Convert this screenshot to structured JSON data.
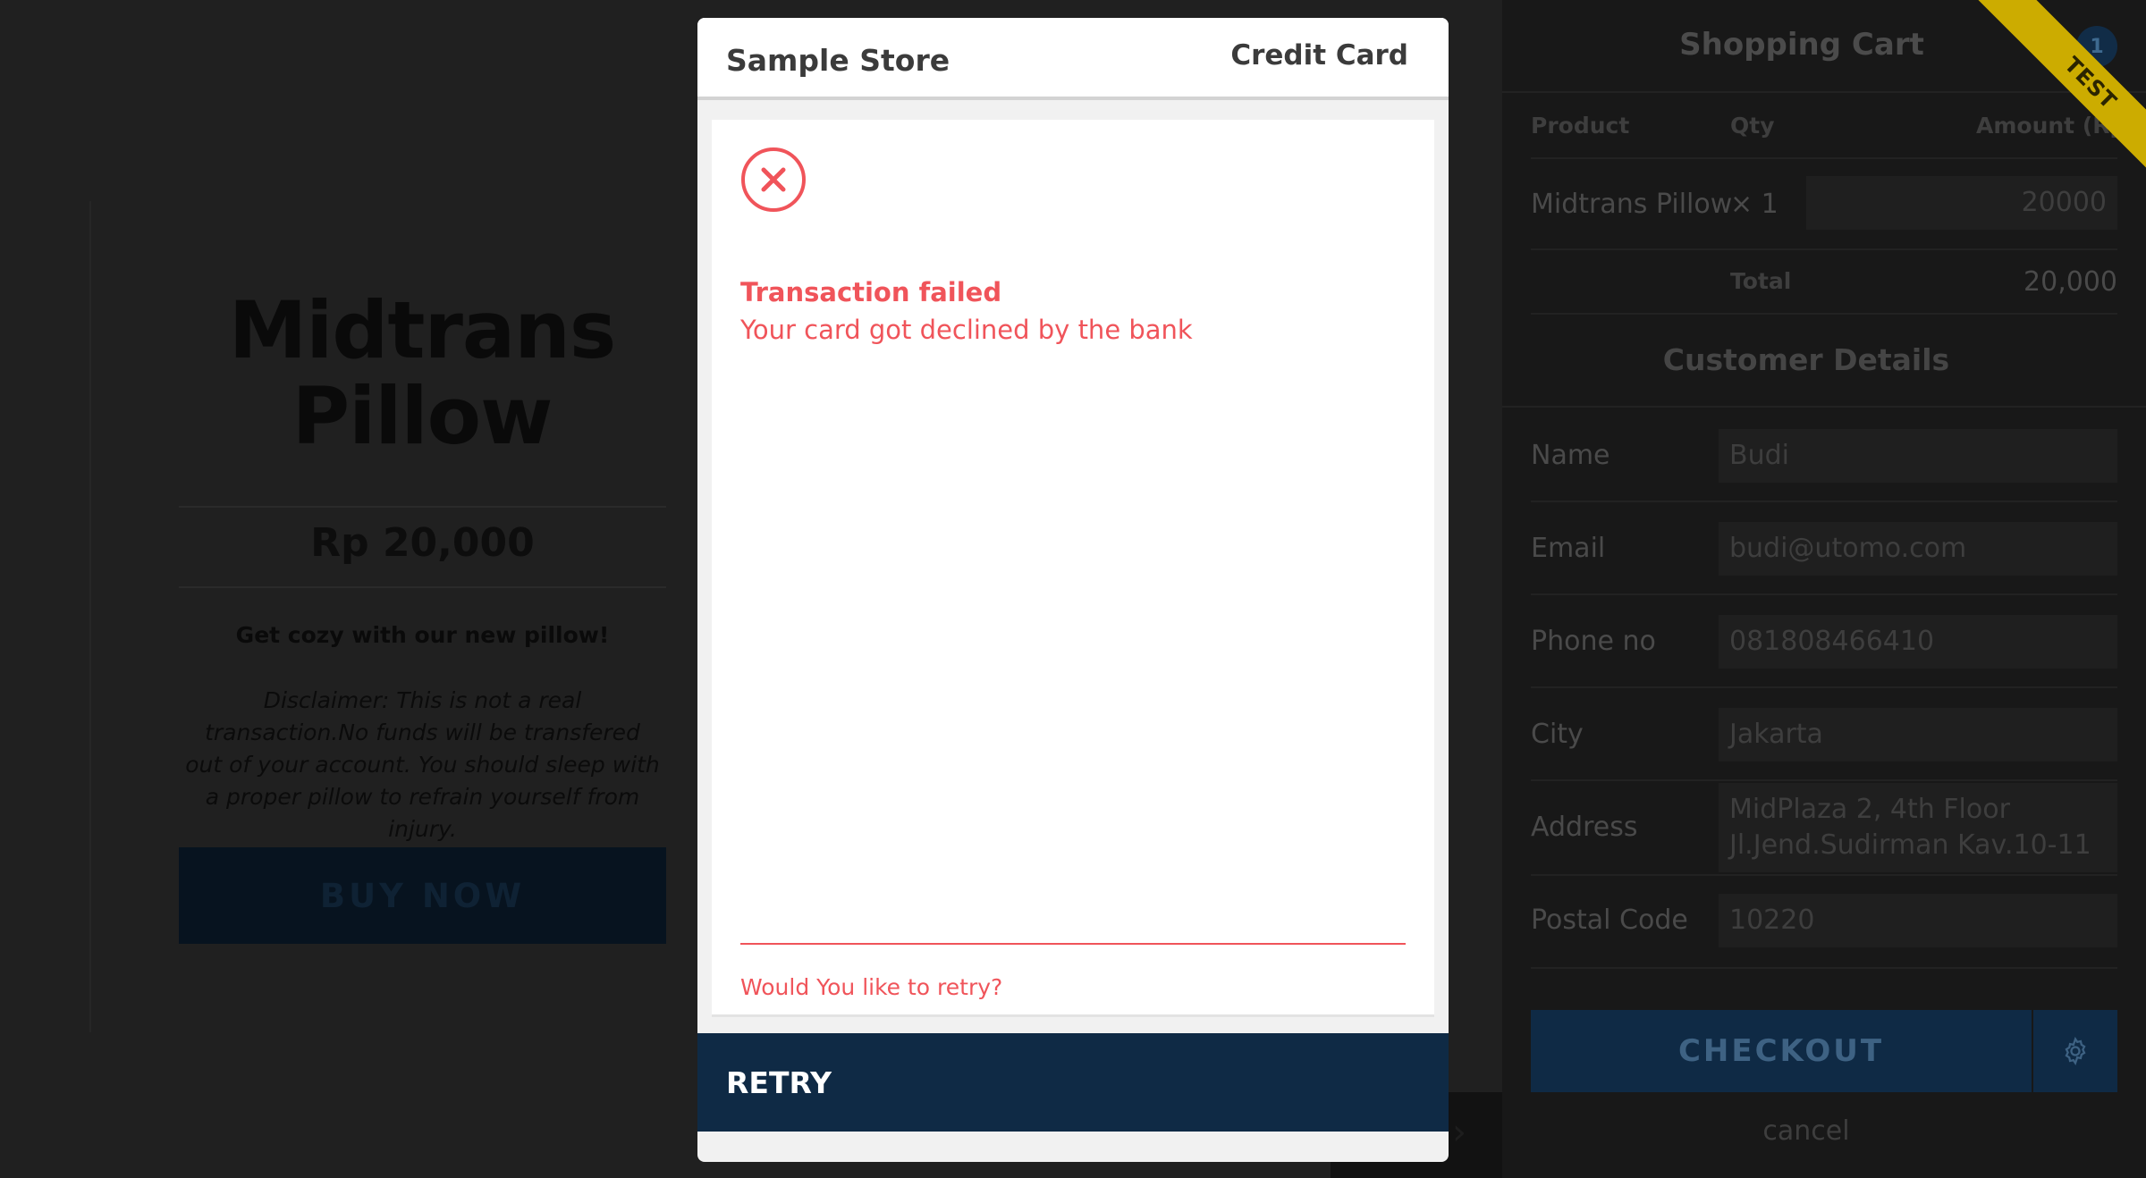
{
  "product": {
    "title": "Midtrans Pillow",
    "price": "Rp 20,000",
    "tagline": "Get cozy with our new pillow!",
    "disclaimer": "Disclaimer: This is not a real transaction.No funds will be transfered out of your account. You should sleep with a proper pillow to refrain yourself from injury.",
    "buy_label": "BUY NOW"
  },
  "cart": {
    "title": "Shopping Cart",
    "badge_count": "1",
    "ribbon": "TEST",
    "headers": {
      "product": "Product",
      "qty": "Qty",
      "amount": "Amount (Rp)"
    },
    "item": {
      "name": "Midtrans Pillow",
      "qty": "× 1",
      "amount": "20000"
    },
    "total_label": "Total",
    "total_value": "20,000",
    "customer_title": "Customer Details",
    "fields": {
      "name": {
        "label": "Name",
        "value": "Budi"
      },
      "email": {
        "label": "Email",
        "value": "budi@utomo.com"
      },
      "phone": {
        "label": "Phone no",
        "value": "081808466410"
      },
      "city": {
        "label": "City",
        "value": "Jakarta"
      },
      "address": {
        "label": "Address",
        "line1": "MidPlaza 2, 4th Floor",
        "line2": "Jl.Jend.Sudirman Kav.10-11"
      },
      "postal": {
        "label": "Postal Code",
        "value": "10220"
      }
    },
    "checkout_label": "CHECKOUT",
    "cancel_label": "cancel"
  },
  "modal": {
    "store_name": "Sample Store",
    "payment_method": "Credit Card",
    "status_title": "Transaction failed",
    "status_message": "Your card got declined by the bank",
    "retry_question": "Would You like to retry?",
    "retry_label": "RETRY"
  },
  "colors": {
    "error": "#f0545a",
    "brand_navy": "#0f2a45",
    "test_ribbon": "#ccac00"
  }
}
